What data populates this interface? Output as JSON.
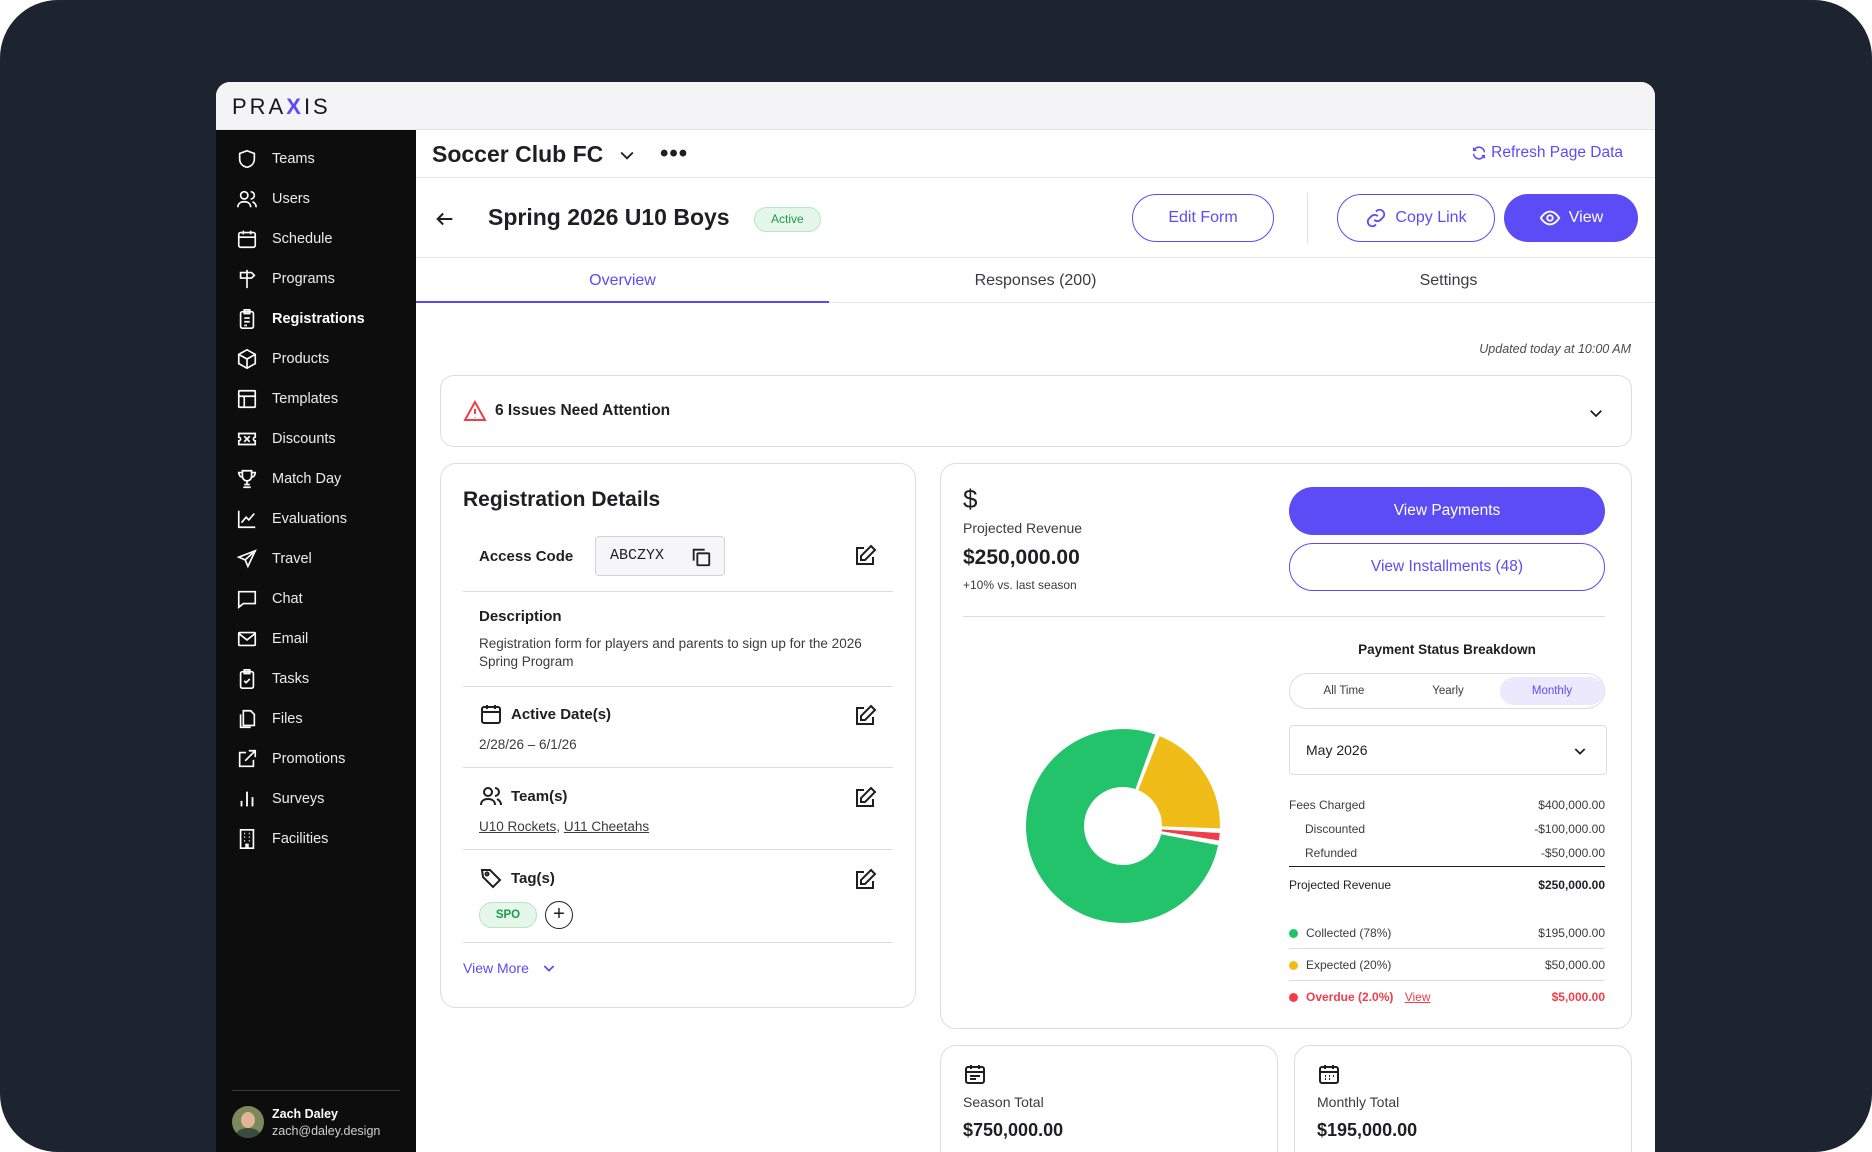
{
  "app": {
    "logo_pre": "PRA",
    "logo_x": "X",
    "logo_post": "IS"
  },
  "sidebar": {
    "items": [
      {
        "label": "Teams"
      },
      {
        "label": "Users"
      },
      {
        "label": "Schedule"
      },
      {
        "label": "Programs"
      },
      {
        "label": "Registrations"
      },
      {
        "label": "Products"
      },
      {
        "label": "Templates"
      },
      {
        "label": "Discounts"
      },
      {
        "label": "Match Day"
      },
      {
        "label": "Evaluations"
      },
      {
        "label": "Travel"
      },
      {
        "label": "Chat"
      },
      {
        "label": "Email"
      },
      {
        "label": "Tasks"
      },
      {
        "label": "Files"
      },
      {
        "label": "Promotions"
      },
      {
        "label": "Surveys"
      },
      {
        "label": "Facilities"
      }
    ],
    "active": "Registrations",
    "user": {
      "name": "Zach Daley",
      "email": "zach@daley.design"
    }
  },
  "header": {
    "org": "Soccer Club FC",
    "refresh": "Refresh Page Data"
  },
  "form": {
    "title": "Spring 2026 U10 Boys",
    "status": "Active",
    "edit_label": "Edit Form",
    "copy_label": "Copy Link",
    "view_label": "View"
  },
  "tabs": [
    {
      "label": "Overview"
    },
    {
      "label": "Responses (200)"
    },
    {
      "label": "Settings"
    }
  ],
  "updated": "Updated today at 10:00 AM",
  "alert": {
    "text": "6 Issues Need Attention"
  },
  "details": {
    "title": "Registration Details",
    "access_label": "Access Code",
    "access_code": "ABCZYX",
    "desc_label": "Description",
    "desc_text": "Registration form for players and parents to sign up for the 2026 Spring Program",
    "dates_label": "Active Date(s)",
    "dates_value": "2/28/26 – 6/1/26",
    "teams_label": "Team(s)",
    "team1": "U10 Rockets",
    "team_sep": ", ",
    "team2": "U11 Cheetahs",
    "tags_label": "Tag(s)",
    "tag1": "SPO",
    "add": "+",
    "view_more": "View More"
  },
  "revenue": {
    "currency_symbol": "$",
    "label": "Projected Revenue",
    "value": "$250,000.00",
    "change": "+10% vs. last season",
    "btn_payments": "View Payments",
    "btn_installments": "View Installments (48)",
    "breakdown_title": "Payment Status Breakdown",
    "periods": [
      "All Time",
      "Yearly",
      "Monthly"
    ],
    "period_selected": "Monthly",
    "month": "May 2026",
    "fees": [
      {
        "label": "Fees Charged",
        "value": "$400,000.00"
      },
      {
        "label": "Discounted",
        "value": "-$100,000.00"
      },
      {
        "label": "Refunded",
        "value": "-$50,000.00"
      }
    ],
    "projected": {
      "label": "Projected Revenue",
      "value": "$250,000.00"
    },
    "status": [
      {
        "label": "Collected (78%)",
        "value": "$195,000.00",
        "color": "#22c36b",
        "pct": 78
      },
      {
        "label": "Expected (20%)",
        "value": "$50,000.00",
        "color": "#f0bc17",
        "pct": 20
      },
      {
        "label": "Overdue (2.0%)",
        "value": "$5,000.00",
        "color": "#ef3e4a",
        "pct": 2,
        "link": "View"
      }
    ]
  },
  "season": {
    "label": "Season Total",
    "value": "$750,000.00"
  },
  "monthly": {
    "label": "Monthly Total",
    "value": "$195,000.00"
  }
}
